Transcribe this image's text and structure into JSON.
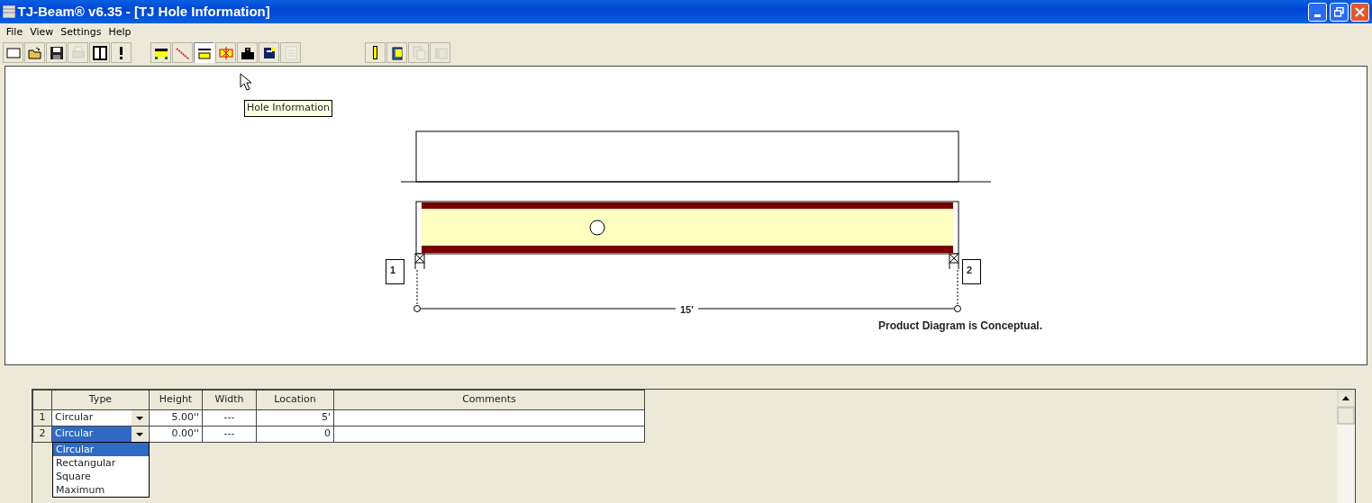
{
  "window": {
    "title": "TJ-Beam® v6.35 - [TJ Hole Information]"
  },
  "menu": [
    "File",
    "View",
    "Settings",
    "Help"
  ],
  "toolbar": [
    [
      {
        "disabled": false,
        "pressed": false
      },
      {
        "disabled": false,
        "pressed": false
      },
      {
        "disabled": false,
        "pressed": false
      },
      {
        "disabled": true,
        "pressed": false
      },
      {
        "disabled": false,
        "pressed": false
      },
      {
        "disabled": false,
        "pressed": false
      }
    ],
    [
      {
        "disabled": false,
        "pressed": false
      },
      {
        "disabled": false,
        "pressed": false
      },
      {
        "disabled": false,
        "pressed": true
      },
      {
        "disabled": false,
        "pressed": false
      },
      {
        "disabled": false,
        "pressed": false
      },
      {
        "disabled": false,
        "pressed": false
      },
      {
        "disabled": true,
        "pressed": false
      }
    ],
    [
      {
        "disabled": false,
        "pressed": false
      },
      {
        "disabled": false,
        "pressed": false
      },
      {
        "disabled": true,
        "pressed": false
      },
      {
        "disabled": true,
        "pressed": false
      }
    ]
  ],
  "tooltip": "Hole Information",
  "diagram": {
    "supports": [
      "1",
      "2"
    ],
    "span": "15'",
    "note": "Product Diagram is Conceptual."
  },
  "table": {
    "columns": [
      "Type",
      "Height",
      "Width",
      "Location",
      "Comments"
    ],
    "rows": [
      {
        "number": "1",
        "type": "Circular",
        "height": "5.00''",
        "width": "---",
        "location": "5'",
        "comments": "",
        "selected": false
      },
      {
        "number": "2",
        "type": "Circular",
        "height": "0.00''",
        "width": "---",
        "location": "0",
        "comments": "",
        "selected": true
      }
    ]
  },
  "dropdown": [
    {
      "label": "Circular",
      "selected": true
    },
    {
      "label": "Rectangular",
      "selected": false
    },
    {
      "label": "Square",
      "selected": false
    },
    {
      "label": "Maximum",
      "selected": false
    }
  ]
}
